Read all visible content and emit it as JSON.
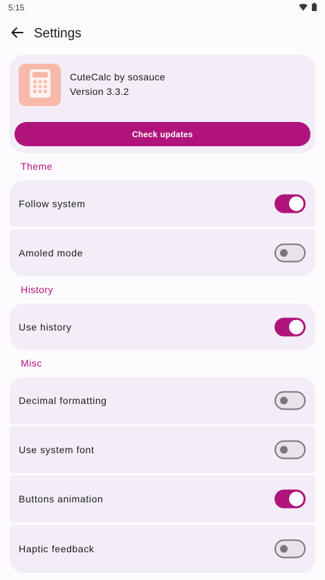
{
  "status_bar": {
    "time": "5:15",
    "icons": [
      "wifi-icon",
      "battery-icon"
    ]
  },
  "top_bar": {
    "back_icon": "arrow-back-icon",
    "title": "Settings"
  },
  "app_card": {
    "icon": "calculator-icon",
    "icon_bg": "#f8b9aa",
    "name": "CuteCalc by sosauce",
    "version": "Version 3.3.2",
    "check_updates_label": "Check updates"
  },
  "colors": {
    "accent": "#b0147c",
    "card": "#f3edf7",
    "background": "#fefbff"
  },
  "sections": {
    "theme": {
      "title": "Theme",
      "items": [
        {
          "label": "Follow system",
          "enabled": true
        },
        {
          "label": "Amoled mode",
          "enabled": false
        }
      ]
    },
    "history": {
      "title": "History",
      "items": [
        {
          "label": "Use history",
          "enabled": true
        }
      ]
    },
    "misc": {
      "title": "Misc",
      "items": [
        {
          "label": "Decimal formatting",
          "enabled": false
        },
        {
          "label": "Use system font",
          "enabled": false
        },
        {
          "label": "Buttons animation",
          "enabled": true
        },
        {
          "label": "Haptic feedback",
          "enabled": false
        }
      ]
    }
  }
}
